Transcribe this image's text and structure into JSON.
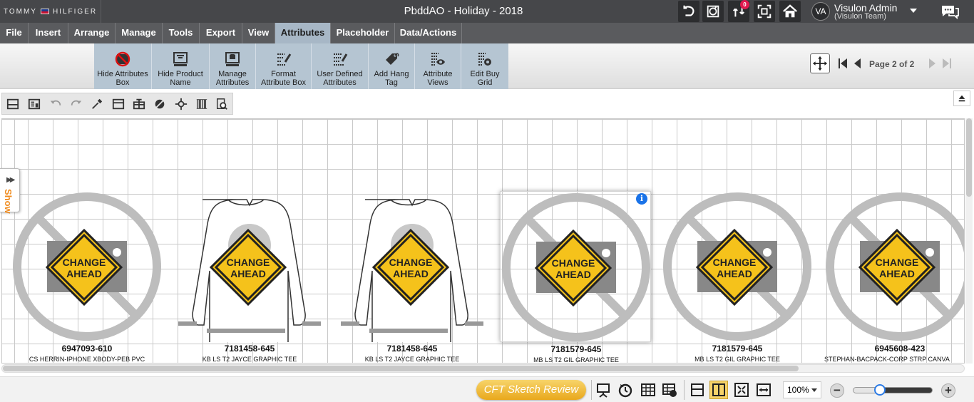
{
  "brand": {
    "name_left": "TOMMY",
    "name_right": "HILFIGER"
  },
  "title": "PbddAO - Holiday - 2018",
  "topbar": {
    "icons": [
      "undo-icon",
      "sync-icon",
      "changes-icon",
      "fullscreen-icon",
      "home-icon"
    ],
    "notification_count": "0"
  },
  "user": {
    "initials": "VA",
    "name": "Visulon Admin",
    "team": "(Visulon Team)"
  },
  "menu": [
    "File",
    "Insert",
    "Arrange",
    "Manage",
    "Tools",
    "Export",
    "View",
    "Attributes",
    "Placeholder",
    "Data/Actions"
  ],
  "menu_active": "Attributes",
  "ribbon": [
    {
      "line1": "Hide Attributes",
      "line2": "Box",
      "icon": "hide-attributes-icon"
    },
    {
      "line1": "Hide Product",
      "line2": "Name",
      "icon": "hide-product-name-icon"
    },
    {
      "line1": "Manage",
      "line2": "Attributes",
      "icon": "manage-attributes-icon"
    },
    {
      "line1": "Format",
      "line2": "Attribute Box",
      "icon": "format-attribute-box-icon"
    },
    {
      "line1": "User Defined",
      "line2": "Attributes",
      "icon": "user-defined-attributes-icon"
    },
    {
      "line1": "Add Hang",
      "line2": "Tag",
      "icon": "hang-tag-icon"
    },
    {
      "line1": "Attribute",
      "line2": "Views",
      "icon": "attribute-views-icon"
    },
    {
      "line1": "Edit Buy",
      "line2": "Grid",
      "icon": "edit-buy-grid-icon"
    }
  ],
  "pager": {
    "label": "Page 2 of 2"
  },
  "side_tab": {
    "label": "Show"
  },
  "placeholder_sign": {
    "line1": "CHANGE",
    "line2": "AHEAD"
  },
  "products": [
    {
      "code": "6947093-610",
      "name": "CS HERRIN-IPHONE XBODY-PEB PVC",
      "image": "no-image"
    },
    {
      "code": "7181458-645",
      "name": "KB LS T2 JAYCE GRAPHIC TEE",
      "image": "sweatshirt"
    },
    {
      "code": "7181458-645",
      "name": "KB LS T2 JAYCE GRAPHIC TEE",
      "image": "sweatshirt"
    },
    {
      "code": "7181579-645",
      "name": "MB LS T2 GIL GRAPHIC TEE",
      "image": "no-image"
    },
    {
      "code": "7181579-645",
      "name": "MB LS T2 GIL GRAPHIC TEE",
      "image": "no-image"
    },
    {
      "code": "6945608-423",
      "name": "STEPHAN-BACPACK-CORP STRP CANVA",
      "image": "no-image"
    }
  ],
  "bottom": {
    "review_button": "CFT Sketch Review",
    "zoom": "100%",
    "zoom_level_percent": 35
  },
  "colors": {
    "topbar": "#46474a",
    "menubar": "#5a5b5e",
    "active_tab": "#a7b7c6",
    "ribbon_group": "#b5c5d2",
    "sign_yellow": "#f5c21b",
    "show_tab_text": "#f08b1d",
    "review_button": "#e9a81c"
  }
}
